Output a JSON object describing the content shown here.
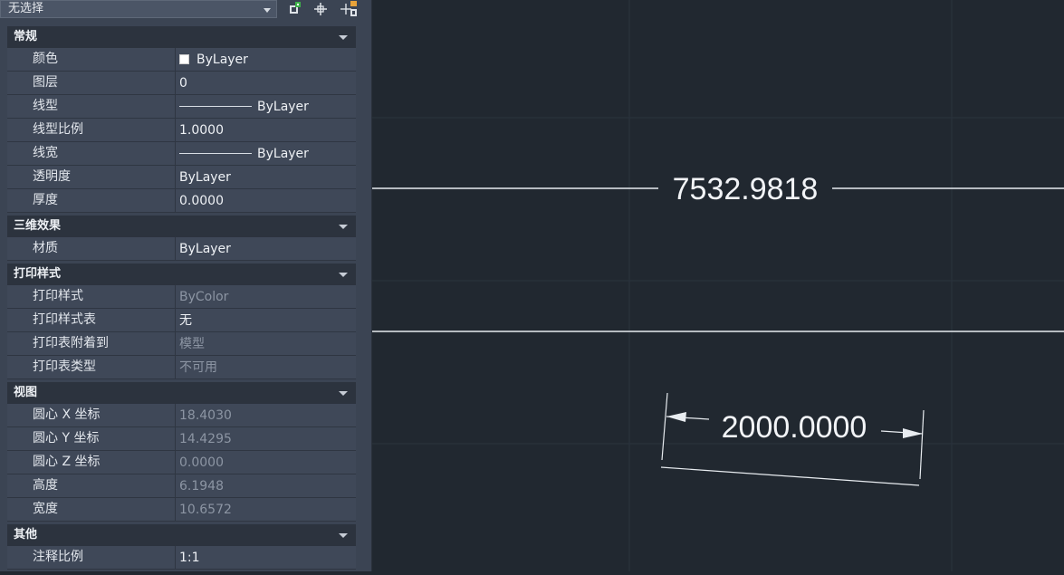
{
  "toolbar": {
    "selection": "无选择",
    "quick_select_icon": "quick-select-icon",
    "select_objects_icon": "select-objects-icon",
    "toggle_pickadd_icon": "toggle-pickadd-icon"
  },
  "sections": [
    {
      "title": "常规",
      "rows": [
        {
          "name": "颜色",
          "value": "ByLayer",
          "swatch": true
        },
        {
          "name": "图层",
          "value": "0"
        },
        {
          "name": "线型",
          "value": "ByLayer",
          "line": true
        },
        {
          "name": "线型比例",
          "value": "1.0000"
        },
        {
          "name": "线宽",
          "value": "ByLayer",
          "line": true
        },
        {
          "name": "透明度",
          "value": "ByLayer"
        },
        {
          "name": "厚度",
          "value": "0.0000"
        }
      ]
    },
    {
      "title": "三维效果",
      "rows": [
        {
          "name": "材质",
          "value": "ByLayer"
        }
      ]
    },
    {
      "title": "打印样式",
      "rows": [
        {
          "name": "打印样式",
          "value": "ByColor",
          "dim": true
        },
        {
          "name": "打印样式表",
          "value": "无"
        },
        {
          "name": "打印表附着到",
          "value": "模型",
          "dim": true
        },
        {
          "name": "打印表类型",
          "value": "不可用",
          "dim": true
        }
      ]
    },
    {
      "title": "视图",
      "rows": [
        {
          "name": "圆心 X 坐标",
          "value": "18.4030",
          "dim": true
        },
        {
          "name": "圆心 Y 坐标",
          "value": "14.4295",
          "dim": true
        },
        {
          "name": "圆心 Z 坐标",
          "value": "0.0000",
          "dim": true
        },
        {
          "name": "高度",
          "value": "6.1948",
          "dim": true
        },
        {
          "name": "宽度",
          "value": "10.6572",
          "dim": true
        }
      ]
    },
    {
      "title": "其他",
      "rows": [
        {
          "name": "注释比例",
          "value": "1:1"
        }
      ]
    }
  ],
  "drawing": {
    "dimension_1": "7532.9818",
    "dimension_2": "2000.0000"
  },
  "colors": {
    "canvas_background": "#212830",
    "palette_background": "#3b4453",
    "geometry": "#e8ecf0"
  }
}
